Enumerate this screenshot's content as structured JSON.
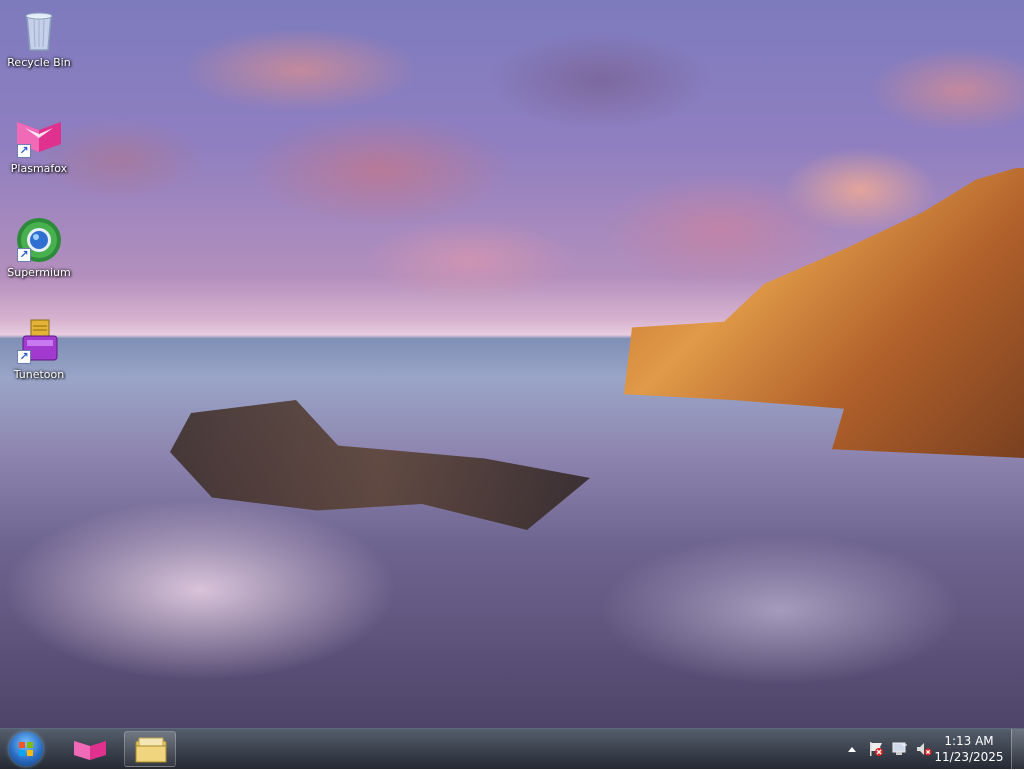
{
  "desktop": {
    "icons": [
      {
        "label": "Recycle Bin",
        "icon": "recycle-bin-icon"
      },
      {
        "label": "Plasmafox",
        "icon": "plasmafox-icon"
      },
      {
        "label": "Supermium",
        "icon": "supermium-icon"
      },
      {
        "label": "Tunetoon",
        "icon": "tunetoon-icon"
      }
    ]
  },
  "taskbar": {
    "start": "start-orb-icon",
    "pinned": [
      {
        "name": "Plasmafox",
        "icon": "plasmafox-icon"
      },
      {
        "name": "Windows Explorer",
        "icon": "folder-icon"
      }
    ],
    "tray": {
      "icons": [
        "show-hidden-icons-arrow",
        "action-center-flag-icon",
        "network-icon",
        "volume-muted-icon"
      ],
      "time": "1:13 AM",
      "date": "11/23/2025"
    }
  },
  "colors": {
    "taskbar": "#1e2430",
    "plasmafox": "#e0318f",
    "tunetoon": "#a23ad0"
  }
}
